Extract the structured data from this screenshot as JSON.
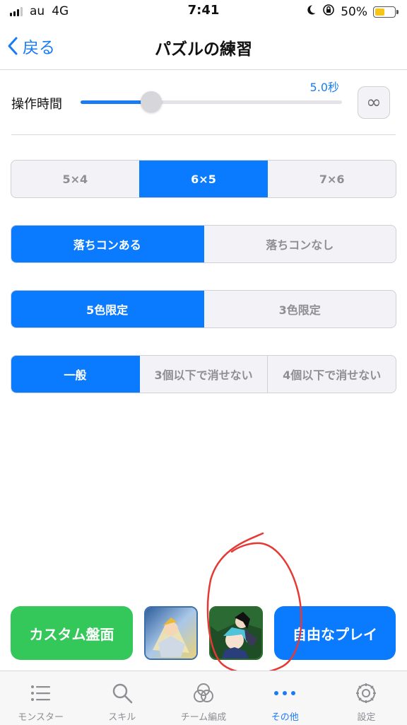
{
  "status_bar": {
    "carrier": "au",
    "network": "4G",
    "time": "7:41",
    "battery": "50%",
    "battery_level": 0.5
  },
  "nav": {
    "back_label": "戻る",
    "title": "パズルの練習"
  },
  "slider": {
    "label": "操作時間",
    "value_text": "5.0秒",
    "position_fraction": 0.27,
    "infinity_symbol": "∞"
  },
  "segments": {
    "board_size": {
      "options": [
        "5×4",
        "6×5",
        "7×6"
      ],
      "selected_index": 1
    },
    "ochicon": {
      "options": [
        "落ちコンある",
        "落ちコンなし"
      ],
      "selected_index": 0
    },
    "colors": {
      "options": [
        "5色限定",
        "3色限定"
      ],
      "selected_index": 0
    },
    "clear_rule": {
      "options": [
        "一般",
        "3個以下で消せない",
        "4個以下で消せない"
      ],
      "selected_index": 0
    }
  },
  "actions": {
    "custom_board": "カスタム盤面",
    "free_play": "自由なプレイ"
  },
  "tabbar": {
    "tabs": [
      {
        "label": "モンスター",
        "icon": "list-icon"
      },
      {
        "label": "スキル",
        "icon": "search-icon"
      },
      {
        "label": "チーム編成",
        "icon": "circles-icon"
      },
      {
        "label": "その他",
        "icon": "more-icon"
      },
      {
        "label": "設定",
        "icon": "gear-icon"
      }
    ],
    "active_index": 3
  },
  "colors": {
    "accent": "#0a7bff",
    "green": "#34c759",
    "annotation": "#e53935"
  }
}
